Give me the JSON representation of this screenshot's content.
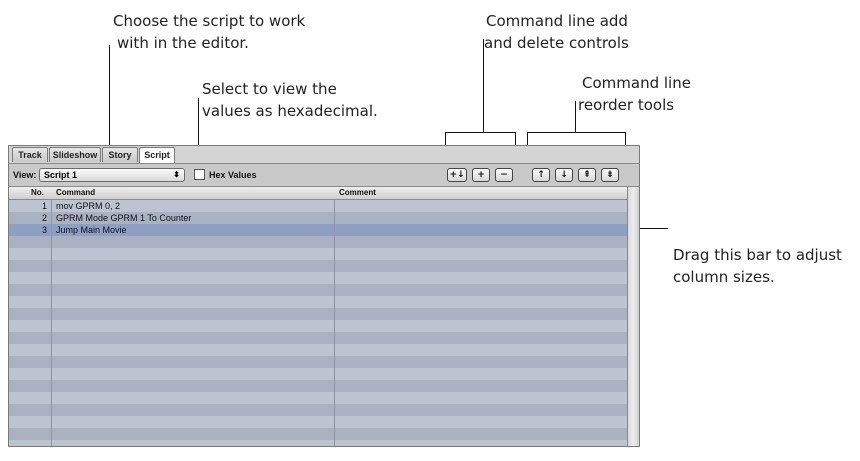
{
  "callouts": {
    "script_choose": [
      "Choose the script to work",
      "with in the editor."
    ],
    "hex_select": [
      "Select to view the",
      "values as hexadecimal."
    ],
    "add_delete": [
      "Command line add",
      "and delete controls"
    ],
    "reorder": [
      "Command line",
      "reorder tools"
    ],
    "column_bar": [
      "Drag this bar to adjust",
      "column sizes."
    ]
  },
  "tabs": [
    "Track",
    "Slideshow",
    "Story",
    "Script"
  ],
  "active_tab": "Script",
  "toolbar": {
    "view_label": "View:",
    "view_value": "Script 1",
    "hex_label": "Hex Values",
    "hex_checked": false,
    "buttons": {
      "insert": "+↓",
      "add": "+",
      "delete": "−",
      "move_up": "↑",
      "move_down": "↓",
      "move_top": "⇞",
      "move_bottom": "⇟"
    }
  },
  "table": {
    "headers": {
      "no": "No.",
      "command": "Command",
      "comment": "Comment"
    },
    "rows": [
      {
        "no": "1",
        "command": "mov GPRM 0, 2",
        "comment": ""
      },
      {
        "no": "2",
        "command": "GPRM Mode GPRM 1 To Counter",
        "comment": ""
      },
      {
        "no": "3",
        "command": "Jump Main Movie",
        "comment": "",
        "selected": true
      }
    ]
  },
  "colors": {
    "row_light": "#bcc3d1",
    "row_dark": "#aab2c2",
    "row_selected": "#8d9fc3"
  }
}
